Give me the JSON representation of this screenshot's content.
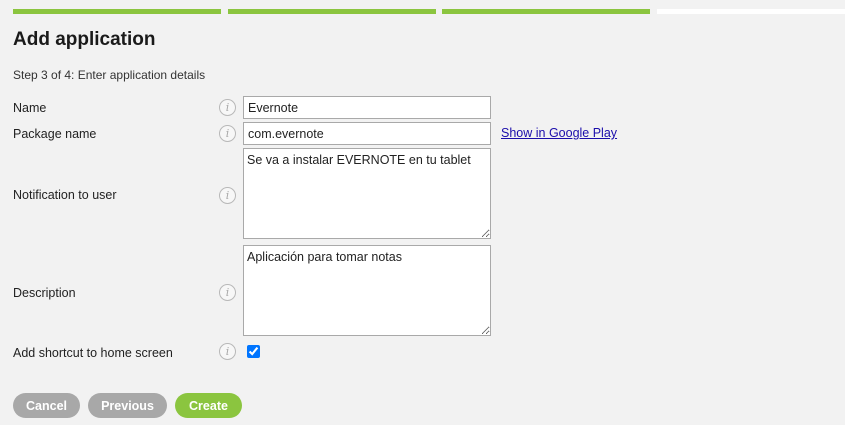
{
  "progress": {
    "total_steps": 4,
    "completed_steps": 3,
    "accent_color": "#8bc53f"
  },
  "page": {
    "title": "Add application",
    "step_text": "Step 3 of 4: Enter application details"
  },
  "form": {
    "name": {
      "label": "Name",
      "value": "Evernote"
    },
    "package": {
      "label": "Package name",
      "value": "com.evernote",
      "link_text": "Show in Google Play"
    },
    "notification": {
      "label": "Notification to user",
      "value": "Se va a instalar EVERNOTE en tu tablet"
    },
    "description": {
      "label": "Description",
      "value": "Aplicación para tomar notas"
    },
    "shortcut": {
      "label": "Add shortcut to home screen",
      "checked": true
    }
  },
  "info_icon_glyph": "i",
  "buttons": {
    "cancel": "Cancel",
    "previous": "Previous",
    "create": "Create"
  }
}
